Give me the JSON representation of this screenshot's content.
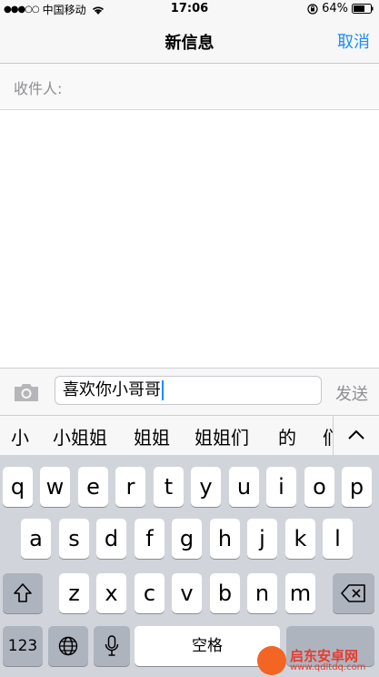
{
  "status_bar": {
    "carrier": "中国移动",
    "time": "17:06",
    "battery": "64%",
    "icons": [
      "signal-dots-icon",
      "wifi-icon",
      "rotation-lock-icon",
      "battery-icon"
    ]
  },
  "nav": {
    "title": "新信息",
    "cancel_label": "取消"
  },
  "recipient": {
    "label": "收件人:"
  },
  "compose": {
    "input_value": "喜欢你小哥哥",
    "send_label": "发送",
    "camera_icon": "camera-icon"
  },
  "candidates": [
    "小",
    "小姐姐",
    "姐姐",
    "姐姐们",
    "的",
    "们"
  ],
  "keyboard": {
    "row1": [
      "q",
      "w",
      "e",
      "r",
      "t",
      "y",
      "u",
      "i",
      "o",
      "p"
    ],
    "row2": [
      "a",
      "s",
      "d",
      "f",
      "g",
      "h",
      "j",
      "k",
      "l"
    ],
    "row3": [
      "z",
      "x",
      "c",
      "v",
      "b",
      "n",
      "m"
    ],
    "num_label": "123",
    "space_label": "空格"
  },
  "watermark": {
    "title": "启东安卓网",
    "url": "www.qdltdq.com"
  },
  "colors": {
    "accent": "#1a8cff",
    "keyboard_bg": "#d1d5db",
    "dark_key": "#aeb4be"
  }
}
